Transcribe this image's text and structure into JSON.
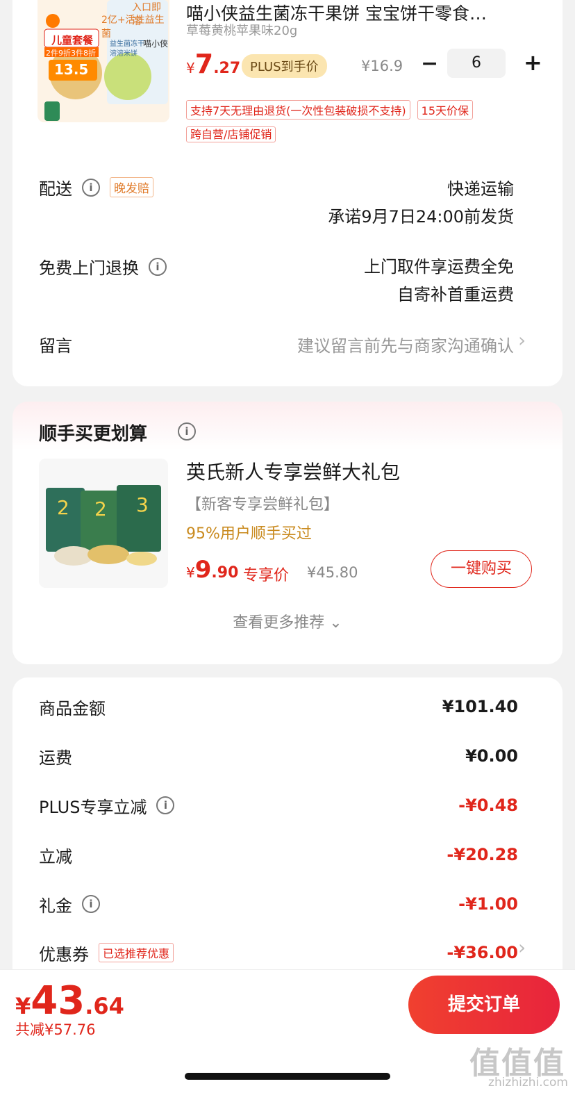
{
  "product": {
    "title": "喵小侠益生菌冻干果饼 宝宝饼干零食…",
    "spec": "草莓黄桃苹果味20g",
    "image_texts": [
      "入口即溶",
      "2亿+活性益生菌",
      "儿童套餐",
      "2件9折3件8折",
      "13.5",
      "益生菌冻干",
      "溶溶米饼",
      "喵小侠"
    ],
    "price_yen": "¥",
    "price_int": "7",
    "price_dec": ".27",
    "plus_badge": "PLUS到手价",
    "old_price": "¥16.9",
    "quantity": "6",
    "minus": "−",
    "plus": "+",
    "tags": [
      "支持7天无理由退货(一次性包装破损不支持)",
      "15天价保",
      "跨自营/店铺促销"
    ]
  },
  "delivery": {
    "label": "配送",
    "late_badge": "晚发赔",
    "method": "快递运输",
    "promise": "承诺9月7日24:00前发货"
  },
  "return_service": {
    "label": "免费上门退换",
    "line1": "上门取件享运费全免",
    "line2": "自寄补首重运费"
  },
  "message": {
    "label": "留言",
    "placeholder": "建议留言前先与商家沟通确认"
  },
  "recommend": {
    "title": "顺手买更划算",
    "item_title": "英氏新人专享尝鲜大礼包",
    "item_sub": "【新客专享尝鲜礼包】",
    "item_ratio": "95%用户顺手买过",
    "price_yen": "¥",
    "price_int": "9",
    "price_dec": ".90",
    "price_label": "专享价",
    "old_price": "¥45.80",
    "buy_label": "一键购买",
    "more_label": "查看更多推荐 ⌄"
  },
  "summary": {
    "rows": [
      {
        "label": "商品金额",
        "value": "¥101.40"
      },
      {
        "label": "运费",
        "value": "¥0.00"
      },
      {
        "label": "PLUS专享立减",
        "value": "-¥0.48"
      },
      {
        "label": "立减",
        "value": "-¥20.28"
      },
      {
        "label": "礼金",
        "value": "-¥1.00"
      },
      {
        "label": "优惠券",
        "value": "-¥36.00",
        "badge": "已选推荐优惠"
      }
    ]
  },
  "bottom": {
    "total_yen": "¥",
    "total_int": "43",
    "total_dec": ".64",
    "saved": "共减¥57.76",
    "submit_label": "提交订单"
  },
  "watermark": {
    "logo": "值值值",
    "url": "zhizhizhi.com"
  },
  "colors": {
    "accent_red": "#e0261b",
    "plus_gold": "#fbe5b0",
    "ratio_orange": "#c98a1e"
  }
}
